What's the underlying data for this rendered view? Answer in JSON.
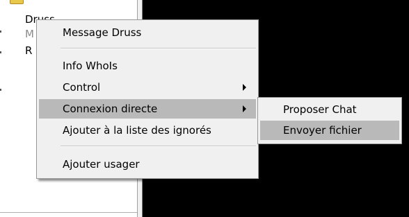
{
  "tree": {
    "selected_item": "Druss",
    "grey_item": "M",
    "third_item": "R"
  },
  "context_menu": {
    "items": [
      {
        "label": "Message Druss"
      },
      {
        "label": "Info WhoIs"
      },
      {
        "label": "Control",
        "has_submenu": true
      },
      {
        "label": "Connexion directe",
        "has_submenu": true,
        "highlighted": true
      },
      {
        "label": "Ajouter à la liste des ignorés"
      },
      {
        "label": "Ajouter usager"
      }
    ]
  },
  "submenu": {
    "items": [
      {
        "label": "Proposer Chat"
      },
      {
        "label": "Envoyer fichier",
        "highlighted": true
      }
    ]
  },
  "colors": {
    "menu_bg": "#f0f0f0",
    "highlight": "#b9b9b9",
    "dark_area": "#000000"
  },
  "icons": {
    "submenu_arrow": "chevron-right-icon",
    "folder": "folder-icon"
  }
}
